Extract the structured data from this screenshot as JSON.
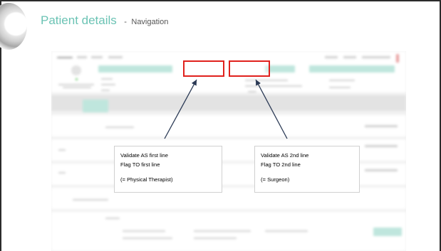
{
  "header": {
    "title": "Patient details",
    "separator": "-",
    "subtitle": "Navigation"
  },
  "callouts": [
    {
      "line1": "Validate  AS first line",
      "line2": "Flag TO first line",
      "line3": "(= Physical Therapist)"
    },
    {
      "line1": "Validate  AS 2nd line",
      "line2": "Flag TO 2nd line",
      "line3": "(= Surgeon)"
    }
  ],
  "colors": {
    "title": "#6bc3b4",
    "highlight_box": "#e0211d",
    "frame": "#2b2b2b"
  }
}
